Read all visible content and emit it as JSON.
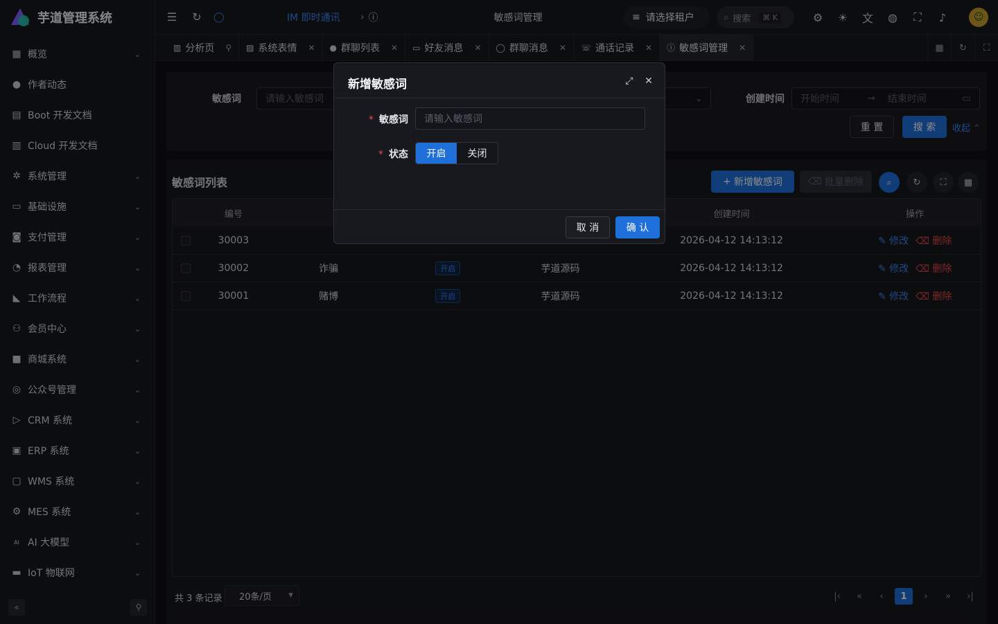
{
  "app": {
    "title": "芋道管理系统"
  },
  "sidebar": {
    "items": [
      {
        "label": "概览",
        "icon": "dashboard-icon",
        "glyph": "▦",
        "chevron": true
      },
      {
        "label": "作者动态",
        "icon": "user-icon",
        "glyph": "●",
        "chevron": false
      },
      {
        "label": "Boot 开发文档",
        "icon": "document-icon",
        "glyph": "▤",
        "chevron": false
      },
      {
        "label": "Cloud 开发文档",
        "icon": "document-icon",
        "glyph": "▥",
        "chevron": false
      },
      {
        "label": "系统管理",
        "icon": "gear-icon",
        "glyph": "✲",
        "chevron": true
      },
      {
        "label": "基础设施",
        "icon": "monitor-icon",
        "glyph": "▭",
        "chevron": true
      },
      {
        "label": "支付管理",
        "icon": "payment-icon",
        "glyph": "◙",
        "chevron": true
      },
      {
        "label": "报表管理",
        "icon": "pie-chart-icon",
        "glyph": "◔",
        "chevron": true
      },
      {
        "label": "工作流程",
        "icon": "workflow-icon",
        "glyph": "◣",
        "chevron": true
      },
      {
        "label": "会员中心",
        "icon": "members-icon",
        "glyph": "⚇",
        "chevron": true
      },
      {
        "label": "商城系统",
        "icon": "shop-icon",
        "glyph": "■",
        "chevron": true
      },
      {
        "label": "公众号管理",
        "icon": "compass-icon",
        "glyph": "◎",
        "chevron": true
      },
      {
        "label": "CRM 系统",
        "icon": "crm-icon",
        "glyph": "▷",
        "chevron": true
      },
      {
        "label": "ERP 系统",
        "icon": "erp-icon",
        "glyph": "▣",
        "chevron": true
      },
      {
        "label": "WMS 系统",
        "icon": "warehouse-icon",
        "glyph": "▢",
        "chevron": true
      },
      {
        "label": "MES 系统",
        "icon": "chip-icon",
        "glyph": "⚙",
        "chevron": true
      },
      {
        "label": "AI 大模型",
        "icon": "ai-icon",
        "glyph": "AI",
        "chevron": true
      },
      {
        "label": "IoT 物联网",
        "icon": "iot-icon",
        "glyph": "▬",
        "chevron": true
      }
    ]
  },
  "header": {
    "breadcrumb": [
      "IM 即时通讯",
      "敏感词管理"
    ],
    "tenant_label": "请选择租户",
    "search_placeholder": "搜索",
    "search_shortcut": "⌘ K"
  },
  "tabs": [
    {
      "label": "分析页",
      "icon": "chart-icon",
      "glyph": "▥",
      "closable": false,
      "pin": true,
      "active": false
    },
    {
      "label": "系统表情",
      "icon": "image-icon",
      "glyph": "▨",
      "closable": true,
      "pin": false,
      "active": false
    },
    {
      "label": "群聊列表",
      "icon": "user-icon",
      "glyph": "●",
      "closable": true,
      "pin": false,
      "active": false
    },
    {
      "label": "好友消息",
      "icon": "chat-icon",
      "glyph": "▭",
      "closable": true,
      "pin": false,
      "active": false
    },
    {
      "label": "群聊消息",
      "icon": "chat-bubble-icon",
      "glyph": "◯",
      "closable": true,
      "pin": false,
      "active": false
    },
    {
      "label": "通话记录",
      "icon": "phone-icon",
      "glyph": "☏",
      "closable": true,
      "pin": false,
      "active": false
    },
    {
      "label": "敏感词管理",
      "icon": "info-icon",
      "glyph": "ⓘ",
      "closable": true,
      "pin": false,
      "active": true
    }
  ],
  "filter": {
    "word_label": "敏感词",
    "word_placeholder": "请输入敏感词",
    "created_label": "创建时间",
    "start_placeholder": "开始时间",
    "end_placeholder": "结束时间",
    "reset_label": "重 置",
    "search_label": "搜 索",
    "collapse_label": "收起"
  },
  "table": {
    "title": "敏感词列表",
    "add_label": "新增敏感词",
    "batch_delete_label": "批量删除",
    "columns": [
      "编号",
      "",
      "",
      "",
      "创建时间",
      "操作"
    ],
    "rows": [
      {
        "id": "30003",
        "word": "",
        "status": "",
        "creator": "",
        "created": "2026-04-12 14:13:12",
        "edit": "修改",
        "delete": "删除"
      },
      {
        "id": "30002",
        "word": "诈骗",
        "status": "开启",
        "creator": "芋道源码",
        "created": "2026-04-12 14:13:12",
        "edit": "修改",
        "delete": "删除"
      },
      {
        "id": "30001",
        "word": "赌博",
        "status": "开启",
        "creator": "芋道源码",
        "created": "2026-04-12 14:13:12",
        "edit": "修改",
        "delete": "删除"
      }
    ]
  },
  "pager": {
    "total_text": "共 3 条记录",
    "page_size": "20条/页",
    "current_page": "1"
  },
  "modal": {
    "title": "新增敏感词",
    "word_label": "敏感词",
    "word_placeholder": "请输入敏感词",
    "status_label": "状态",
    "status_on": "开启",
    "status_off": "关闭",
    "required_mark": "*",
    "cancel_label": "取 消",
    "confirm_label": "确 认"
  },
  "colors": {
    "primary": "#1e6fd9",
    "danger": "#e5484d",
    "background": "#14151a"
  }
}
